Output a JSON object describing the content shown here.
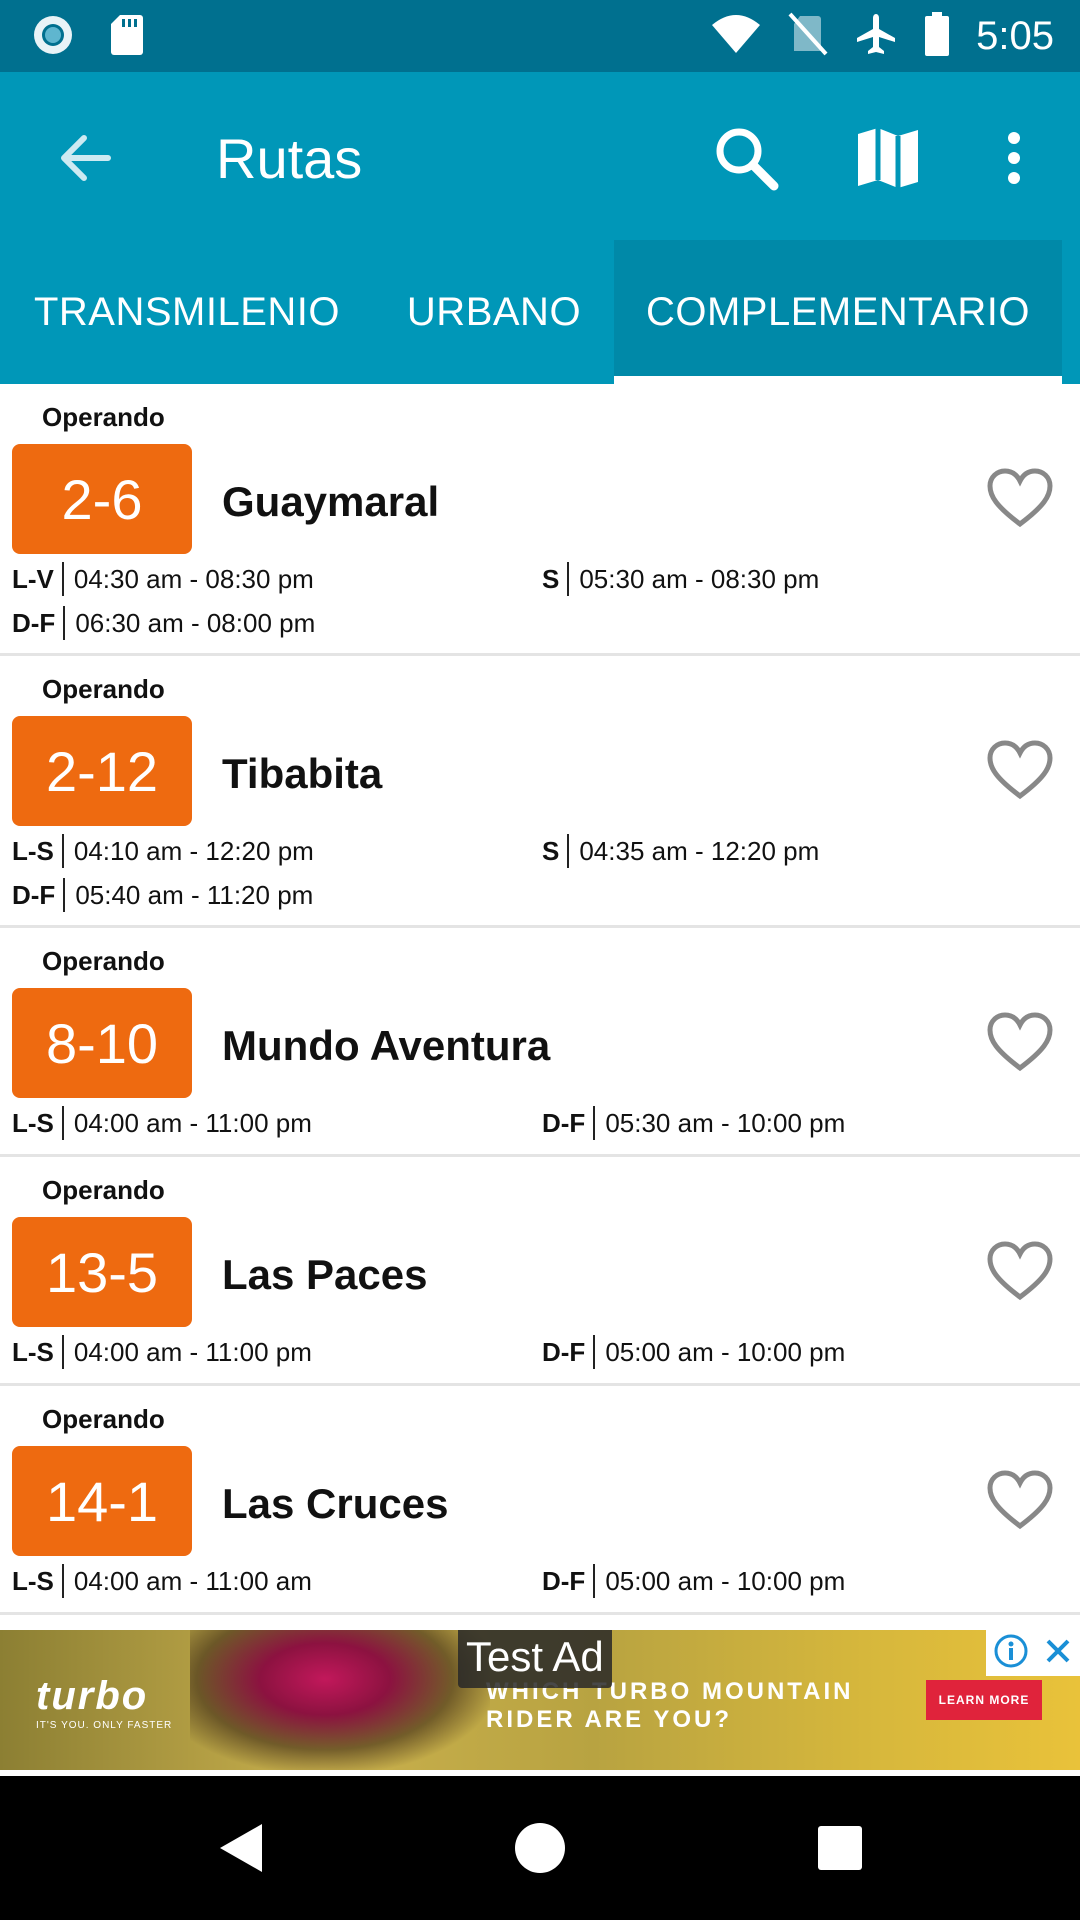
{
  "status_bar": {
    "time": "5:05",
    "icons": [
      "record-icon",
      "sd-card-icon",
      "wifi-icon",
      "no-sim-icon",
      "airplane-icon",
      "battery-icon"
    ]
  },
  "toolbar": {
    "title": "Rutas",
    "actions": [
      "search-icon",
      "map-icon",
      "more-vert-icon"
    ]
  },
  "tabs": [
    {
      "label": "TRANSMILENIO",
      "selected": false
    },
    {
      "label": "URBANO",
      "selected": false
    },
    {
      "label": "COMPLEMENTARIO",
      "selected": true
    }
  ],
  "colors": {
    "primary": "#0097b8",
    "primary_dark": "#00708f",
    "badge": "#ee6a10",
    "heart": "#888888"
  },
  "routes": [
    {
      "status": "Operando",
      "code": "2-6",
      "name": "Guaymaral",
      "schedules": [
        {
          "days": "L-V",
          "hours": "04:30 am - 08:30 pm"
        },
        {
          "days": "S",
          "hours": "05:30 am - 08:30 pm"
        },
        {
          "days": "D-F",
          "hours": "06:30 am - 08:00 pm"
        }
      ]
    },
    {
      "status": "Operando",
      "code": "2-12",
      "name": "Tibabita",
      "schedules": [
        {
          "days": "L-S",
          "hours": "04:10 am - 12:20 pm"
        },
        {
          "days": "S",
          "hours": "04:35 am - 12:20 pm"
        },
        {
          "days": "D-F",
          "hours": "05:40 am - 11:20 pm"
        }
      ]
    },
    {
      "status": "Operando",
      "code": "8-10",
      "name": "Mundo Aventura",
      "schedules": [
        {
          "days": "L-S",
          "hours": "04:00 am - 11:00 pm"
        },
        {
          "days": "D-F",
          "hours": "05:30 am - 10:00 pm"
        }
      ]
    },
    {
      "status": "Operando",
      "code": "13-5",
      "name": "Las Paces",
      "schedules": [
        {
          "days": "L-S",
          "hours": "04:00 am - 11:00 pm"
        },
        {
          "days": "D-F",
          "hours": "05:00 am - 10:00 pm"
        }
      ]
    },
    {
      "status": "Operando",
      "code": "14-1",
      "name": "Las Cruces",
      "schedules": [
        {
          "days": "L-S",
          "hours": "04:00 am - 11:00 am"
        },
        {
          "days": "D-F",
          "hours": "05:00 am - 10:00 pm"
        }
      ]
    }
  ],
  "ad": {
    "label": "Test Ad",
    "brand": "turbo",
    "brand_tagline": "IT'S YOU. ONLY FASTER",
    "headline_1": "WHICH TURBO MOUNTAIN",
    "headline_2": "RIDER ARE YOU?",
    "cta": "LEARN MORE"
  },
  "nav_bar": [
    "back-icon",
    "home-icon",
    "recents-icon"
  ]
}
